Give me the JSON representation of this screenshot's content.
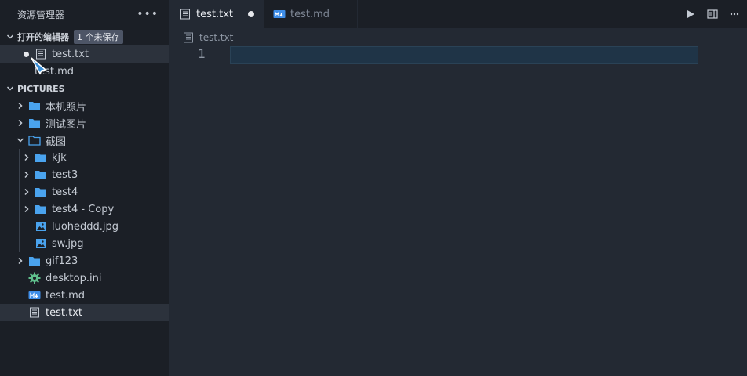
{
  "explorer": {
    "title": "资源管理器",
    "more_label": "•••",
    "open_editors": {
      "header": "打开的编辑器",
      "badge": "1 个未保存",
      "items": [
        {
          "label": "test.txt"
        },
        {
          "label": "test.md"
        }
      ]
    },
    "folder": {
      "header": "PICTURES",
      "items": [
        {
          "label": "本机照片"
        },
        {
          "label": "测试图片"
        },
        {
          "label": "截图"
        },
        {
          "label": "kjk"
        },
        {
          "label": "test3"
        },
        {
          "label": "test4"
        },
        {
          "label": "test4 - Copy"
        },
        {
          "label": "luoheddd.jpg"
        },
        {
          "label": "sw.jpg"
        },
        {
          "label": "gif123"
        },
        {
          "label": "desktop.ini"
        },
        {
          "label": "test.md"
        },
        {
          "label": "test.txt"
        }
      ]
    }
  },
  "tabs": [
    {
      "label": "test.txt"
    },
    {
      "label": "test.md"
    }
  ],
  "breadcrumb": {
    "label": "test.txt"
  },
  "editor": {
    "line_number": "1"
  },
  "colors": {
    "folder": "#4aa3ee",
    "markdown": "#3f8ee8",
    "settings": "#5fbf8c",
    "sidebar_bg": "#1b1f26",
    "editor_bg": "#232933"
  }
}
